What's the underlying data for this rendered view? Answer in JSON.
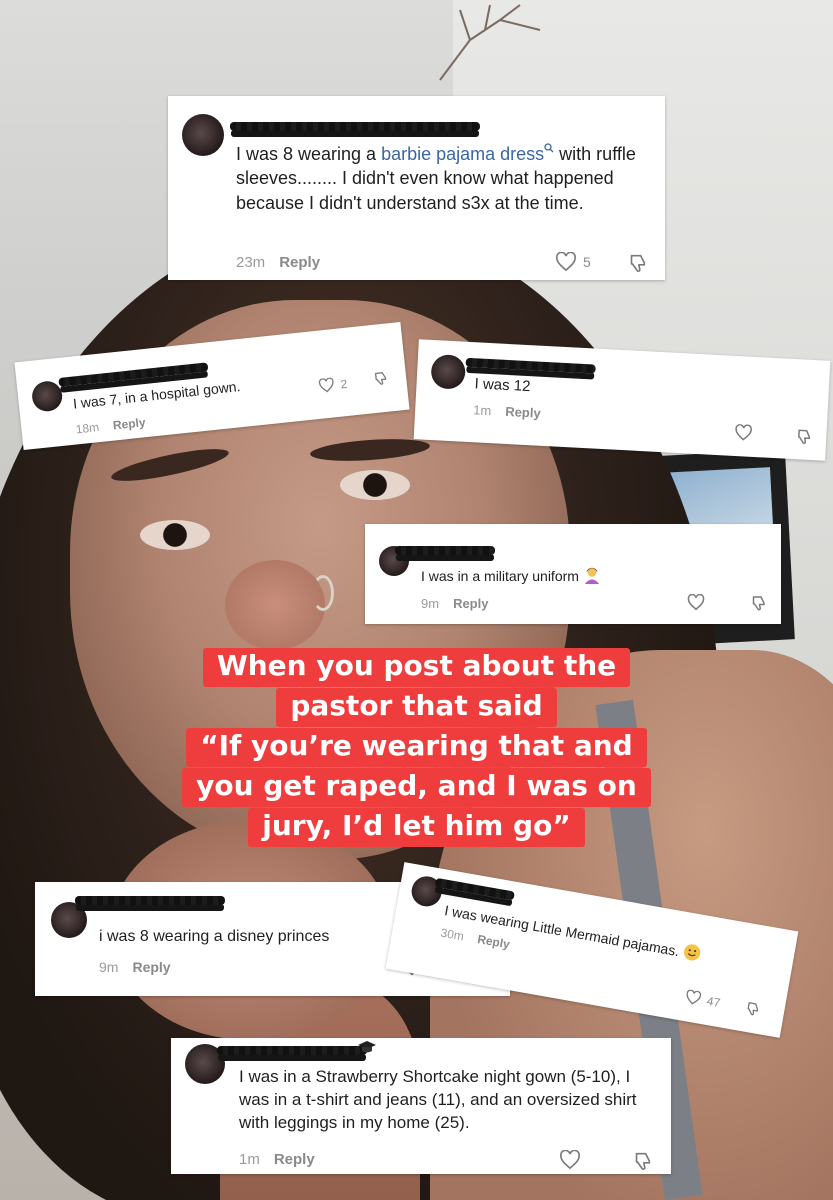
{
  "caption": {
    "lines": [
      "When you post about the",
      "pastor that said",
      "“If you’re wearing that and",
      "you get raped, and I was on",
      "jury, I’d let him go”"
    ]
  },
  "comments": [
    {
      "text_parts": [
        "I was 8 wearing a ",
        "barbie pajama dress",
        " with ruffle sleeves........ I didn't even know what happened because I didn't understand s3x at the time."
      ],
      "time": "23m",
      "reply": "Reply",
      "likes": "5"
    },
    {
      "text": "I was 7, in a hospital gown.",
      "time": "18m",
      "reply": "Reply",
      "likes": "2"
    },
    {
      "text": "I was 12",
      "time": "1m",
      "reply": "Reply"
    },
    {
      "text": "I was in a military uniform",
      "time": "9m",
      "reply": "Reply",
      "peek_meta": "30m Reply",
      "peek_count": "30"
    },
    {
      "text": "i was 8 wearing a disney princes",
      "time": "9m",
      "reply": "Reply"
    },
    {
      "text": "I was wearing Little Mermaid pajamas.",
      "time": "30m",
      "reply": "Reply",
      "likes": "47"
    },
    {
      "text": "I was in a Strawberry Shortcake night gown (5-10), I was in a t-shirt and jeans (11), and an oversized shirt with leggings in my home (25).",
      "time": "1m",
      "reply": "Reply"
    }
  ]
}
